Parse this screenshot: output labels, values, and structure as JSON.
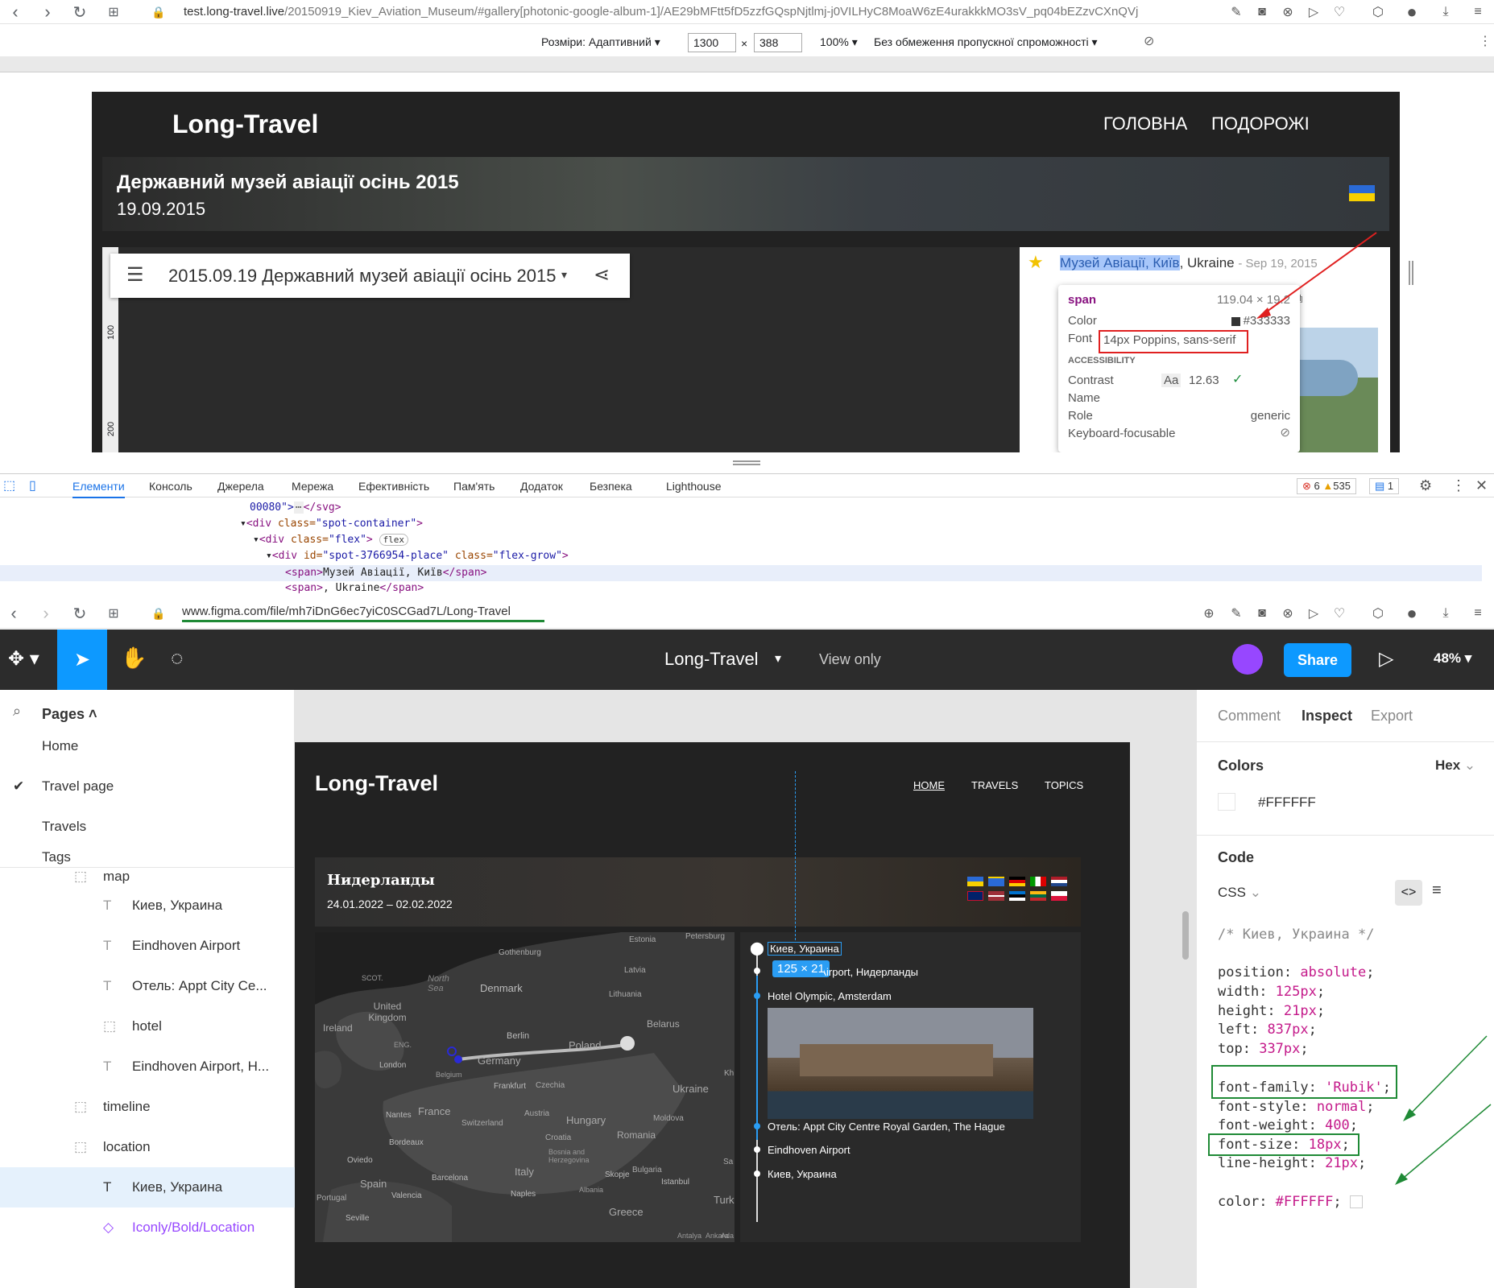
{
  "browser_top": {
    "url_prefix": "test.long-travel.live",
    "url_rest": "/20150919_Kiev_Aviation_Museum/#gallery[photonic-google-album-1]/AE29bMFtt5fD5zzfGQspNjtlmj-j0VILHyC8MoaW6zE4urakkkMO3sV_pq04bEZzvCXnQVj"
  },
  "device_bar": {
    "size_label": "Розміри: Адаптивний",
    "width": "1300",
    "times": "×",
    "height": "388",
    "zoom": "100%",
    "throttle": "Без обмеження пропускної спроможності"
  },
  "site": {
    "logo": "Long-Travel",
    "nav": [
      "ГОЛОВНА",
      "ПОДОРОЖІ"
    ],
    "hero_title": "Державний музей авіації осінь 2015",
    "hero_date": "19.09.2015",
    "album_title": "2015.09.19 Державний музей авіації осінь 2015",
    "ruler_marks": [
      "100",
      "200"
    ],
    "place_highlight": "Музей Авіації, Київ",
    "place_rest": ", Ukraine",
    "place_date": "- Sep 19, 2015"
  },
  "tooltip": {
    "tag": "span",
    "size": "119.04 × 19.2",
    "color_label": "Color",
    "color_value": "#333333",
    "font_label": "Font",
    "font_value": "14px Poppins, sans-serif",
    "section": "ACCESSIBILITY",
    "contrast_label": "Contrast",
    "contrast_aa": "Aa",
    "contrast_value": "12.63",
    "name_label": "Name",
    "role_label": "Role",
    "role_value": "generic",
    "kb_label": "Keyboard-focusable"
  },
  "devtools": {
    "tabs": [
      "Елементи",
      "Консоль",
      "Джерела",
      "Мережа",
      "Ефективність",
      "Пам'ять",
      "Додаток",
      "Безпека",
      "Lighthouse"
    ],
    "errors": "6",
    "warnings": "535",
    "messages": "1",
    "code_lines": [
      {
        "tag_open": "00080\">",
        "rest": "</svg>"
      },
      {
        "tag_open": "<div ",
        "attr": "class=",
        "val": "\"spot-container\"",
        "close": ">"
      },
      {
        "tag_open": "<div ",
        "attr": "class=",
        "val": "\"flex\"",
        "close": ">",
        "badge": "flex"
      },
      {
        "tag_open": "<div ",
        "attr": "id=",
        "val": "\"spot-3766954-place\"",
        "attr2": " class=",
        "val2": "\"flex-grow\"",
        "close": ">"
      },
      {
        "tag_open": "<span>",
        "text": "Музей Авіації, Київ",
        "close": "</span>"
      },
      {
        "tag_open": "<span>",
        "text": ", Ukraine",
        "close": "</span>"
      }
    ]
  },
  "browser_bottom": {
    "url": "www.figma.com/file/mh7iDnG6ec7yiC0SCGad7L/Long-Travel"
  },
  "figma": {
    "file_name": "Long-Travel",
    "view_mode": "View only",
    "share": "Share",
    "zoom": "48%",
    "pages_label": "Pages",
    "pages": [
      "Home",
      "Travel page",
      "Travels",
      "Tags"
    ],
    "active_page": "Travel page",
    "layers": [
      {
        "type": "frame",
        "name": "map",
        "indent": 1
      },
      {
        "type": "text",
        "name": "Киев, Украина",
        "indent": 2
      },
      {
        "type": "text",
        "name": "Eindhoven Airport",
        "indent": 2
      },
      {
        "type": "text",
        "name": "Отель: Appt City Ce...",
        "indent": 2
      },
      {
        "type": "frame",
        "name": "hotel",
        "indent": 2
      },
      {
        "type": "text",
        "name": "Eindhoven Airport, H...",
        "indent": 2
      },
      {
        "type": "frame",
        "name": "timeline",
        "indent": 1
      },
      {
        "type": "frame",
        "name": "location",
        "indent": 1
      },
      {
        "type": "text",
        "name": "Киев, Украина",
        "indent": 2,
        "selected": true
      },
      {
        "type": "component",
        "name": "Iconly/Bold/Location",
        "indent": 2
      }
    ],
    "design": {
      "logo": "Long-Travel",
      "nav": [
        "HOME",
        "TRAVELS",
        "TOPICS"
      ],
      "title": "Нидерланды",
      "dates": "24.01.2022 – 02.02.2022",
      "selection_size": "125 × 21",
      "timeline": [
        "Киев, Украина",
        "Eindhoven Airport, Нидерланды",
        "Hotel Olympic, Amsterdam",
        "Отель: Appt City Centre Royal Garden, The Hague",
        "Eindhoven Airport",
        "Киев, Украина"
      ],
      "map_labels": [
        "Estonia",
        "Petersburg",
        "Gothenburg",
        "Latvia",
        "SCOT.",
        "North Sea",
        "Denmark",
        "Lithuania",
        "United Kingdom",
        "Ireland",
        "Belarus",
        "ENG.",
        "Berlin",
        "Poland",
        "London",
        "Belgium",
        "Germany",
        "Ukraine",
        "Frankfurt",
        "Czechia",
        "France",
        "Austria",
        "Hungary",
        "Moldova",
        "Nantes",
        "Switzerland",
        "Romania",
        "Bordeaux",
        "Croatia",
        "Oviedo",
        "Bosnia and Herzegovina",
        "Bulgaria",
        "Italy",
        "Skopje",
        "Spain",
        "Barcelona",
        "Istanbul",
        "Portugal",
        "Valencia",
        "Naples",
        "Albania",
        "Turk",
        "Seville",
        "Greece",
        "Antalya",
        "Ankara",
        "Kh",
        "Sa",
        "Ada"
      ]
    },
    "inspect": {
      "tabs": [
        "Comment",
        "Inspect",
        "Export"
      ],
      "colors_label": "Colors",
      "format": "Hex",
      "color_value": "#FFFFFF",
      "code_label": "Code",
      "lang": "CSS",
      "comment": "/* Киев, Украина */",
      "props": [
        {
          "k": "position",
          "v": "absolute"
        },
        {
          "k": "width",
          "v": "125px"
        },
        {
          "k": "height",
          "v": "21px"
        },
        {
          "k": "left",
          "v": "837px"
        },
        {
          "k": "top",
          "v": "337px"
        },
        {
          "k": "font-family",
          "v": "'Rubik'"
        },
        {
          "k": "font-style",
          "v": "normal"
        },
        {
          "k": "font-weight",
          "v": "400"
        },
        {
          "k": "font-size",
          "v": "18px"
        },
        {
          "k": "line-height",
          "v": "21px"
        },
        {
          "k": "color",
          "v": "#FFFFFF"
        }
      ]
    }
  }
}
